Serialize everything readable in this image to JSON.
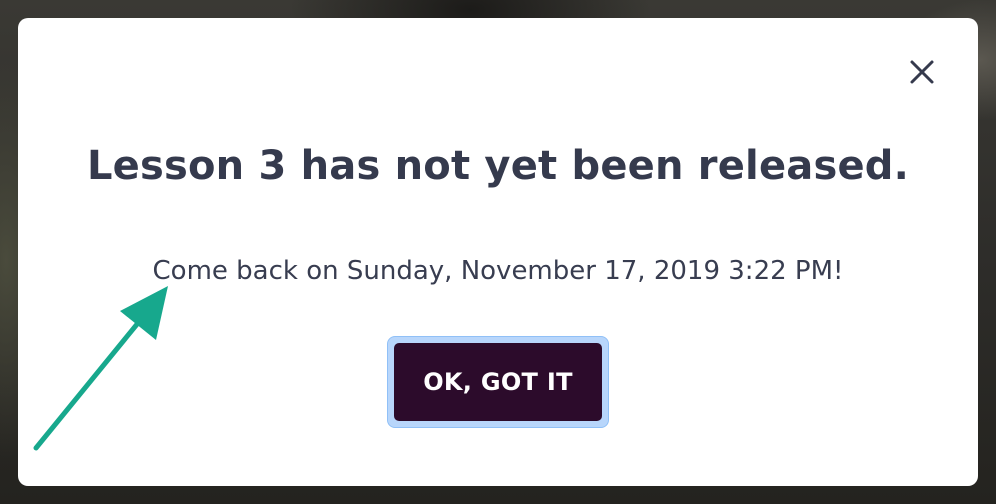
{
  "modal": {
    "title": "Lesson 3 has not yet been released.",
    "message": "Come back on Sunday, November 17, 2019 3:22 PM!",
    "ok_label": "OK, GOT IT",
    "close_icon": "close-icon"
  },
  "annotation": {
    "icon": "arrow-icon",
    "color": "#17a88d"
  },
  "colors": {
    "dialog_bg": "#ffffff",
    "title_text": "#353a4d",
    "button_bg": "#2c0b2b",
    "button_focus_ring": "#b8d6fb"
  }
}
